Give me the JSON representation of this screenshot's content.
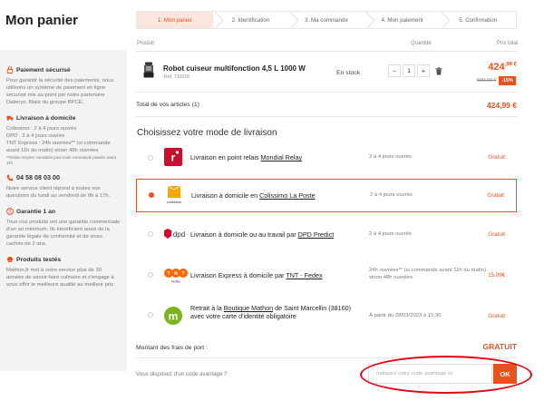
{
  "page_title": "Mon panier",
  "steps": [
    {
      "label": "1. Mon panier",
      "active": true
    },
    {
      "label": "2. Identification",
      "active": false
    },
    {
      "label": "3. Ma commande",
      "active": false
    },
    {
      "label": "4. Mon paiement",
      "active": false
    },
    {
      "label": "5. Confirmation",
      "active": false
    }
  ],
  "table_headers": {
    "product": "Produit",
    "quantity": "Quantité",
    "total": "Prix total"
  },
  "product": {
    "name": "Robot cuiseur multifonction 4,5 L 1000 W",
    "ref": "Réf. 711018",
    "stock": "En stock",
    "quantity": "1",
    "price_main": "424",
    "price_cents": ",99 €",
    "price_old": "599,99 €",
    "discount": "-15%"
  },
  "total": {
    "label": "Total de vos articles (1)",
    "value": "424,99 €"
  },
  "delivery": {
    "title": "Choisissez votre mode de livraison",
    "options": [
      {
        "label_pre": "Livraison en point relais ",
        "label_link": "Mondial Relay",
        "label_post": "",
        "delay": "2 à 4 jours ouvrés",
        "cost": "Gratuit",
        "selected": false,
        "logo": "mondial-relay-logo"
      },
      {
        "label_pre": "Livraison à domicile en ",
        "label_link": "Colissimo La Poste",
        "label_post": "",
        "delay": "2 à 4 jours ouvrés",
        "cost": "Gratuit",
        "selected": true,
        "logo": "colissimo-logo"
      },
      {
        "label_pre": "Livraison à domicile ou au travail par ",
        "label_link": "DPD Predict",
        "label_post": "",
        "delay": "2 à 4 jours ouvrés",
        "cost": "Gratuit",
        "selected": false,
        "logo": "dpd-logo"
      },
      {
        "label_pre": "Livraison Express à domicile par ",
        "label_link": "TNT - Fedex",
        "label_post": "",
        "delay": "24h ouvrées** (si commande avant 11h du matin) sinon 48h ouvrées",
        "cost": "15,99€",
        "selected": false,
        "logo": "tnt-logo"
      },
      {
        "label_pre": "Retrait à la ",
        "label_link": "Boutique Mathon",
        "label_post": " de Saint Marcellin (38160) avec votre carte d'identité obligatoire",
        "delay": "À partir du 28/03/2023 à 15:30",
        "cost": "Gratuit",
        "selected": false,
        "logo": "mathon-logo"
      }
    ]
  },
  "shipping": {
    "label": "Montant des frais de port :",
    "value": "GRATUIT"
  },
  "promo": {
    "label": "Vous disposez d'un code avantage ?",
    "placeholder": "Indiquez votre code avantage ici",
    "button": "OK"
  },
  "sidebar": {
    "secure": {
      "title": "Paiement sécurisé",
      "text": "Pour garantir la sécurité des paiements, nous utilisons un système de paiement en ligne sécurisé mis au point par notre partenaire Dalenys, filiale du groupe BPCE."
    },
    "home_delivery": {
      "title": "Livraison à domicile",
      "lines": [
        "Colissimo : 2 à 4 jours ouvrés",
        "DPD : 2 à 4 jours ouvrés",
        "TNT Express : 24h ouvrées** (si commande avant 11h du matin) sinon 48h ouvrées"
      ],
      "note": "**Délais moyens constatés pour toute commande passée avant 11h"
    },
    "phone": {
      "number": "04 58 08 03 00",
      "text": "Notre service client répond à toutes vos questions du lundi au vendredi de 9h à 17h."
    },
    "warranty": {
      "title": "Garantie 1 an",
      "text": "Tous nos produits ont une garantie commerciale d'un an minimum. Ils bénéficient aussi de la garantie légale de conformité et de vices cachés de 2 ans."
    },
    "tested": {
      "title": "Produits testés",
      "text": "Mathon.fr met à votre service plus de 30 années de savoir-faire culinaire et s'engage à vous offrir le meilleure qualité au meilleur prix."
    }
  },
  "colors": {
    "accent": "#e8521f",
    "annotation": "#e30613"
  }
}
